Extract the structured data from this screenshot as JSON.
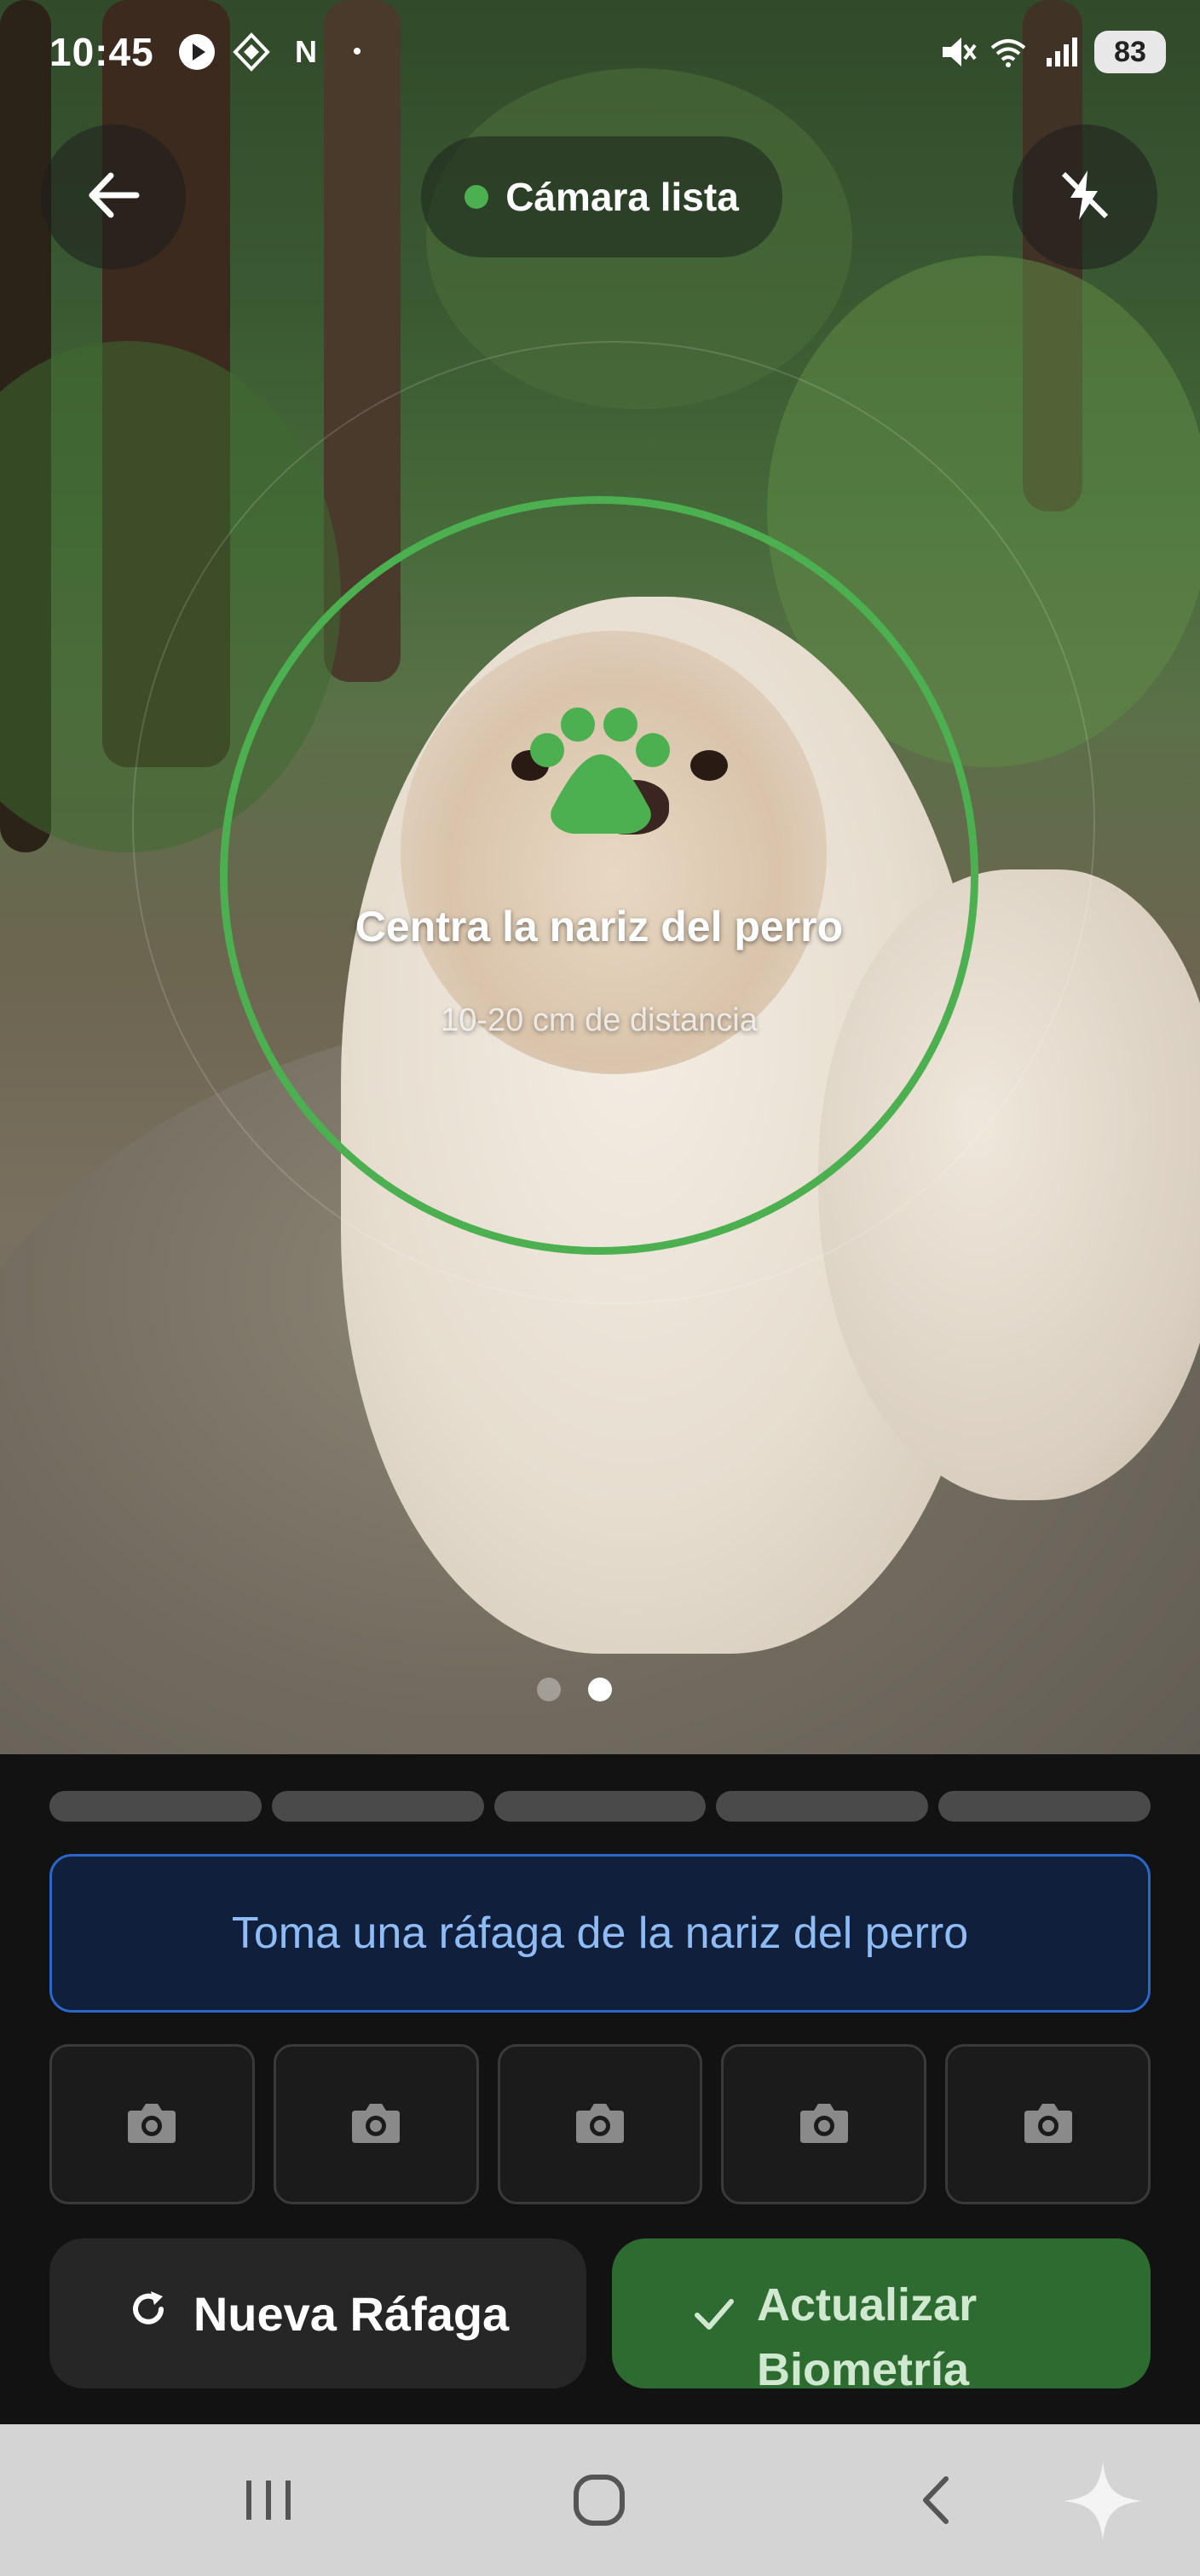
{
  "status_bar": {
    "time": "10:45",
    "notification_icons": [
      "play-icon",
      "shield-icon",
      "n-icon"
    ],
    "battery": "83"
  },
  "camera": {
    "status_label": "Cámara lista",
    "status_color": "#4caf50",
    "guide_title": "Centra la nariz del perro",
    "guide_subtitle": "10-20 cm de distancia",
    "page_count": 2,
    "active_page": 2
  },
  "panel": {
    "progress_segments": 5,
    "progress_filled": 0,
    "instruction": "Toma una ráfaga de la nariz del perro",
    "thumbnails": 5,
    "new_burst_label": "Nueva Ráfaga",
    "update_label": "Actualizar Biometría",
    "accent": "#2e6b30",
    "info_color": "#2b66c9"
  }
}
